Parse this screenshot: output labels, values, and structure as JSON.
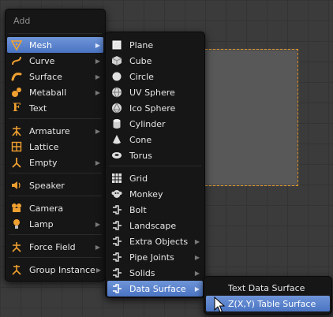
{
  "add_menu": {
    "title": "Add",
    "items": [
      {
        "label": "Mesh",
        "icon": "mesh-icon",
        "submenu": true,
        "active": true
      },
      {
        "label": "Curve",
        "icon": "curve-icon",
        "submenu": true
      },
      {
        "label": "Surface",
        "icon": "surface-icon",
        "submenu": true
      },
      {
        "label": "Metaball",
        "icon": "metaball-icon",
        "submenu": true
      },
      {
        "label": "Text",
        "icon": "text-icon",
        "submenu": false
      },
      {
        "label": "Armature",
        "icon": "armature-icon",
        "submenu": true
      },
      {
        "label": "Lattice",
        "icon": "lattice-icon",
        "submenu": false
      },
      {
        "label": "Empty",
        "icon": "empty-icon",
        "submenu": true
      },
      {
        "label": "Speaker",
        "icon": "speaker-icon",
        "submenu": false
      },
      {
        "label": "Camera",
        "icon": "camera-icon",
        "submenu": false
      },
      {
        "label": "Lamp",
        "icon": "lamp-icon",
        "submenu": true
      },
      {
        "label": "Force Field",
        "icon": "force-field-icon",
        "submenu": true
      },
      {
        "label": "Group Instance",
        "icon": "group-instance-icon",
        "submenu": true
      }
    ]
  },
  "mesh_menu": {
    "items": [
      {
        "label": "Plane",
        "icon": "plane-icon"
      },
      {
        "label": "Cube",
        "icon": "cube-icon"
      },
      {
        "label": "Circle",
        "icon": "circle-icon"
      },
      {
        "label": "UV Sphere",
        "icon": "uv-sphere-icon"
      },
      {
        "label": "Ico Sphere",
        "icon": "ico-sphere-icon"
      },
      {
        "label": "Cylinder",
        "icon": "cylinder-icon"
      },
      {
        "label": "Cone",
        "icon": "cone-icon"
      },
      {
        "label": "Torus",
        "icon": "torus-icon"
      },
      {
        "label": "Grid",
        "icon": "grid-icon"
      },
      {
        "label": "Monkey",
        "icon": "monkey-icon"
      },
      {
        "label": "Bolt",
        "icon": "plugin-icon"
      },
      {
        "label": "Landscape",
        "icon": "plugin-icon"
      },
      {
        "label": "Extra Objects",
        "icon": "plugin-icon",
        "submenu": true
      },
      {
        "label": "Pipe Joints",
        "icon": "plugin-icon",
        "submenu": true
      },
      {
        "label": "Solids",
        "icon": "plugin-icon",
        "submenu": true
      },
      {
        "label": "Data Surface",
        "icon": "plugin-icon",
        "submenu": true,
        "active": true
      }
    ]
  },
  "data_surface_menu": {
    "items": [
      {
        "label": "Text Data Surface"
      },
      {
        "label": "Z(X,Y) Table Surface",
        "active": true
      }
    ]
  },
  "colors": {
    "accent": "#5680c8",
    "selection_outline": "#e89a2a",
    "menu_bg": "#161616"
  }
}
